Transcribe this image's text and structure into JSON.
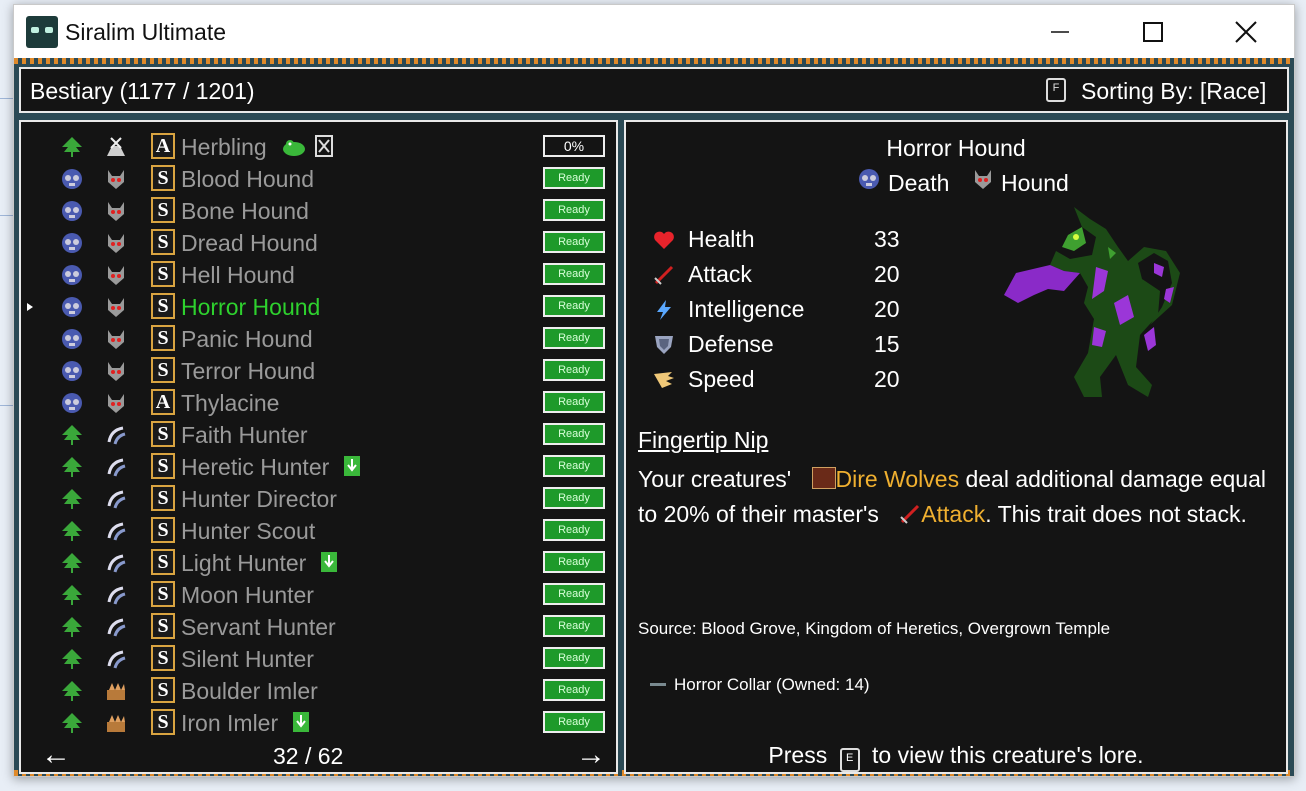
{
  "window": {
    "title": "Siralim Ultimate"
  },
  "header": {
    "bestiary_label": "Bestiary (1177 / 1201)",
    "sort_key": "F",
    "sort_label": "Sorting By: [Race]"
  },
  "creatures": [
    {
      "name": "Herbling",
      "race_icon": "nature-tree-icon",
      "class_icon": "herbling-class-icon",
      "rank": "A",
      "status": "0%",
      "extra_icon": "herbling-mini-icon",
      "extra2_icon": "x-box-icon"
    },
    {
      "name": "Blood Hound",
      "race_icon": "death-skull-icon",
      "class_icon": "hound-icon",
      "rank": "S",
      "status": "Ready"
    },
    {
      "name": "Bone Hound",
      "race_icon": "death-skull-icon",
      "class_icon": "hound-icon",
      "rank": "S",
      "status": "Ready"
    },
    {
      "name": "Dread Hound",
      "race_icon": "death-skull-icon",
      "class_icon": "hound-icon",
      "rank": "S",
      "status": "Ready"
    },
    {
      "name": "Hell Hound",
      "race_icon": "death-skull-icon",
      "class_icon": "hound-icon",
      "rank": "S",
      "status": "Ready"
    },
    {
      "name": "Horror Hound",
      "race_icon": "death-skull-icon",
      "class_icon": "hound-icon",
      "rank": "S",
      "status": "Ready",
      "selected": true
    },
    {
      "name": "Panic Hound",
      "race_icon": "death-skull-icon",
      "class_icon": "hound-icon",
      "rank": "S",
      "status": "Ready"
    },
    {
      "name": "Terror Hound",
      "race_icon": "death-skull-icon",
      "class_icon": "hound-icon",
      "rank": "S",
      "status": "Ready"
    },
    {
      "name": "Thylacine",
      "race_icon": "death-skull-icon",
      "class_icon": "hound-icon",
      "rank": "A",
      "status": "Ready"
    },
    {
      "name": "Faith Hunter",
      "race_icon": "nature-tree-icon",
      "class_icon": "hunter-icon",
      "rank": "S",
      "status": "Ready"
    },
    {
      "name": "Heretic Hunter",
      "race_icon": "nature-tree-icon",
      "class_icon": "hunter-icon",
      "rank": "S",
      "status": "Ready",
      "extra_icon": "download-icon"
    },
    {
      "name": "Hunter Director",
      "race_icon": "nature-tree-icon",
      "class_icon": "hunter-icon",
      "rank": "S",
      "status": "Ready"
    },
    {
      "name": "Hunter Scout",
      "race_icon": "nature-tree-icon",
      "class_icon": "hunter-icon",
      "rank": "S",
      "status": "Ready"
    },
    {
      "name": "Light Hunter",
      "race_icon": "nature-tree-icon",
      "class_icon": "hunter-icon",
      "rank": "S",
      "status": "Ready",
      "extra_icon": "download-icon"
    },
    {
      "name": "Moon Hunter",
      "race_icon": "nature-tree-icon",
      "class_icon": "hunter-icon",
      "rank": "S",
      "status": "Ready"
    },
    {
      "name": "Servant Hunter",
      "race_icon": "nature-tree-icon",
      "class_icon": "hunter-icon",
      "rank": "S",
      "status": "Ready"
    },
    {
      "name": "Silent Hunter",
      "race_icon": "nature-tree-icon",
      "class_icon": "hunter-icon",
      "rank": "S",
      "status": "Ready"
    },
    {
      "name": "Boulder Imler",
      "race_icon": "nature-tree-icon",
      "class_icon": "imler-icon",
      "rank": "S",
      "status": "Ready"
    },
    {
      "name": "Iron Imler",
      "race_icon": "nature-tree-icon",
      "class_icon": "imler-icon",
      "rank": "S",
      "status": "Ready",
      "extra_icon": "download-icon"
    }
  ],
  "pager": {
    "label": "32 / 62",
    "prev": "←",
    "next": "→"
  },
  "detail": {
    "name": "Horror Hound",
    "race": "Death",
    "race_icon": "death-skull-icon",
    "creature_class": "Hound",
    "class_icon": "hound-icon",
    "stats": [
      {
        "label": "Health",
        "value": "33",
        "icon": "heart-icon",
        "color": "#e8232b"
      },
      {
        "label": "Attack",
        "value": "20",
        "icon": "sword-icon",
        "color": "#d02020"
      },
      {
        "label": "Intelligence",
        "value": "20",
        "icon": "lightning-icon",
        "color": "#5aa8ff"
      },
      {
        "label": "Defense",
        "value": "15",
        "icon": "shield-icon",
        "color": "#9aa4c0"
      },
      {
        "label": "Speed",
        "value": "20",
        "icon": "wing-icon",
        "color": "#f0c878"
      }
    ],
    "trait_name": "Fingertip Nip",
    "trait_text": {
      "p1": "Your creatures'",
      "link1": "Dire Wolves",
      "p2": "deal additional damage equal to 20% of their master's",
      "link2": "Attack",
      "p3": ". This trait does not stack."
    },
    "source": "Source: Blood Grove, Kingdom of Heretics, Overgrown Temple",
    "artifact": "Horror Collar (Owned: 14)",
    "lore": {
      "pre": "Press",
      "key": "E",
      "post": "to view this creature's lore."
    }
  },
  "colors": {
    "highlight": "#f0b030",
    "selected": "#2ed12e",
    "ready": "#1e9a2a",
    "panel_bg": "#141414"
  }
}
